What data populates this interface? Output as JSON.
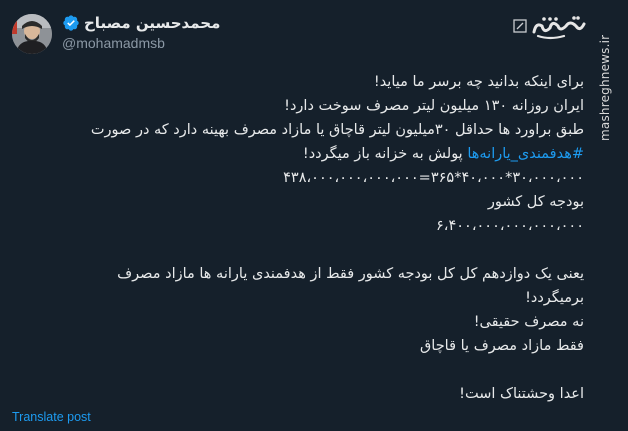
{
  "author": {
    "name": "محمدحسین مصباح",
    "handle": "@mohamadmsb"
  },
  "watermark": {
    "logo_text": "مشرق",
    "side_text": "mashreghnews.ir"
  },
  "tweet": {
    "l1": "برای اینکه بدانید چه برسر ما میاید!",
    "l2": "ایران روزانه ۱۳۰ میلیون لیتر مصرف سوخت دارد!",
    "l3": "طبق براورد ها حداقل ۳۰میلیون لیتر قاچاق یا مازاد مصرف بهینه دارد که در صورت",
    "l4_hashtag": "#هدفمندی_یارانه‌ها",
    "l4_rest": " پولش به خزانه باز میگردد!",
    "l5": "۳۰،۰۰۰،۰۰۰*۴۰،۰۰۰*۳۶۵=۴۳۸،۰۰۰،۰۰۰،۰۰۰،۰۰۰",
    "l6": "بودجه کل کشور",
    "l7": "۶،۴۰۰،۰۰۰،۰۰۰،۰۰۰،۰۰۰",
    "l8": "یعنی یک دوازدهم کل کل بودجه کشور فقط از هدفمندی یارانه ها مازاد مصرف",
    "l9": "برمیگردد!",
    "l10": "نه مصرف حقیقی!",
    "l11": "فقط مازاد مصرف یا قاچاق",
    "l12": "اعدا وحشتناک است!"
  },
  "translate_label": "Translate post",
  "colors": {
    "background": "#15202b",
    "link": "#1d9bf0",
    "verified": "#1d9bf0"
  }
}
